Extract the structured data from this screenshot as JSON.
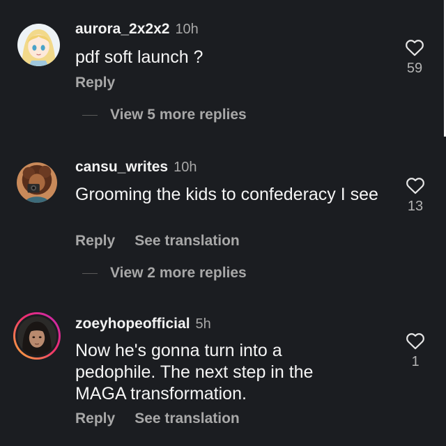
{
  "comments": [
    {
      "username": "aurora_2x2x2",
      "time": "10h",
      "text": "pdf soft launch ?",
      "reply_label": "Reply",
      "translate_label": "",
      "likes": "59",
      "avatar_icon": "anime-girl-avatar",
      "view_replies": "View 5 more replies"
    },
    {
      "username": "cansu_writes",
      "time": "10h",
      "text": "Grooming the kids to confederacy I see",
      "reply_label": "Reply",
      "translate_label": "See translation",
      "likes": "13",
      "avatar_icon": "illustrated-photographer-avatar",
      "view_replies": "View 2 more replies"
    },
    {
      "username": "zoeyhopeofficial",
      "time": "5h",
      "text": "Now he's gonna turn into a pedophile. The next step in the MAGA transformation.",
      "reply_label": "Reply",
      "translate_label": "See translation",
      "likes": "1",
      "avatar_icon": "portrait-avatar-with-story-ring",
      "view_replies": ""
    }
  ],
  "colors": {
    "background": "#1b1d21",
    "text_primary": "#f5f5f5",
    "text_secondary": "#a8a8a8",
    "story_ring_start": "#f9b338",
    "story_ring_end": "#c227b8"
  }
}
